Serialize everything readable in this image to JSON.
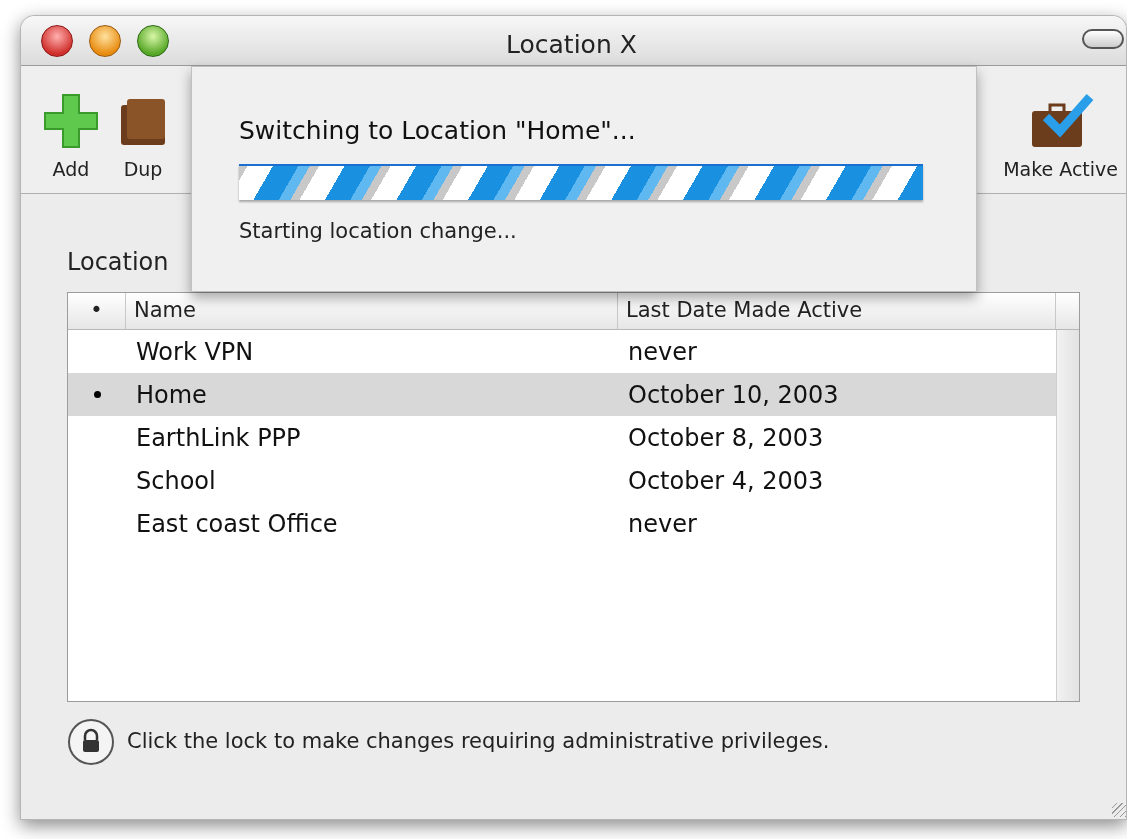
{
  "window": {
    "title": "Location X"
  },
  "toolbar": [
    {
      "kind": "add",
      "label": "Add"
    },
    {
      "kind": "duplicate",
      "label": "Dup"
    },
    {
      "kind": "make_active",
      "label": "Make Active"
    }
  ],
  "sheet": {
    "title": "Switching to Location \"Home\"...",
    "progress": {
      "indeterminate": true
    },
    "status": "Starting location change..."
  },
  "locations_label": "Location",
  "table": {
    "columns": [
      "•",
      "Name",
      "Last Date Made Active"
    ],
    "rows": [
      {
        "name": "Work VPN",
        "last_active": "never",
        "active": false,
        "selected": false
      },
      {
        "name": "Home",
        "last_active": "October 10, 2003",
        "active": true,
        "selected": true
      },
      {
        "name": "EarthLink PPP",
        "last_active": "October 8, 2003",
        "active": false,
        "selected": false
      },
      {
        "name": "School",
        "last_active": "October 4, 2003",
        "active": false,
        "selected": false
      },
      {
        "name": "East coast Office",
        "last_active": "never",
        "active": false,
        "selected": false
      }
    ]
  },
  "lock_message": "Click the lock to make changes requiring administrative privileges."
}
